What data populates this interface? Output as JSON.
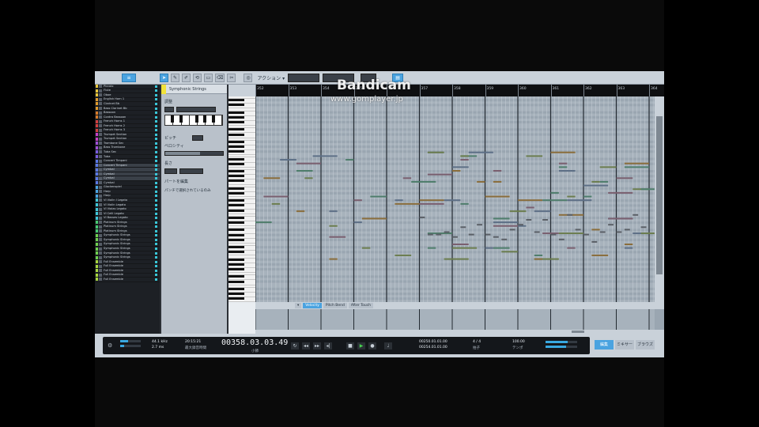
{
  "toolbar": {
    "buttons": [
      "✎",
      "✐",
      "⟲",
      "▭",
      "⌫",
      "✂"
    ],
    "action_label": "アクション ▾",
    "box1": "",
    "box2": "",
    "box3": ""
  },
  "tracks": [
    {
      "name": "Piccolo",
      "color": "#e8c53a"
    },
    {
      "name": "Flute",
      "color": "#e8c53a"
    },
    {
      "name": "Oboe",
      "color": "#e8c53a"
    },
    {
      "name": "English Horn 1",
      "color": "#e09a2c"
    },
    {
      "name": "Clarinet Bb",
      "color": "#e09a2c"
    },
    {
      "name": "Bass Clarinet Bb",
      "color": "#e09a2c"
    },
    {
      "name": "Bassoon",
      "color": "#d67b2a"
    },
    {
      "name": "Contra Bassoon",
      "color": "#d67b2a"
    },
    {
      "name": "French Horns 1",
      "color": "#d13f3f"
    },
    {
      "name": "French Horns 2",
      "color": "#d13f3f"
    },
    {
      "name": "French Horns 3",
      "color": "#d13f3f"
    },
    {
      "name": "Trumpet Section",
      "color": "#c83ec8"
    },
    {
      "name": "Trumpet Section",
      "color": "#c83ec8"
    },
    {
      "name": "Trombone Sec",
      "color": "#a04fd6"
    },
    {
      "name": "Bass Trombone",
      "color": "#a04fd6"
    },
    {
      "name": "Tuba Sec",
      "color": "#7a5ce0"
    },
    {
      "name": "Tuba",
      "color": "#7a5ce0"
    },
    {
      "name": "Concert Timpani",
      "color": "#5a78e6"
    },
    {
      "name": "Concert Timpani",
      "color": "#5a78e6"
    },
    {
      "name": "Cymbal",
      "color": "#5a78e6"
    },
    {
      "name": "Cymbal",
      "color": "#5a78e6"
    },
    {
      "name": "Cymbal",
      "color": "#5a78e6"
    },
    {
      "name": "Cymbal",
      "color": "#5a78e6"
    },
    {
      "name": "Glockenspiel",
      "color": "#4aa3e0"
    },
    {
      "name": "Harp",
      "color": "#4aa3e0"
    },
    {
      "name": "Harp",
      "color": "#4aa3e0"
    },
    {
      "name": "VI Violin I Legato",
      "color": "#3fc7d8"
    },
    {
      "name": "VI Violin Legato",
      "color": "#3fc7d8"
    },
    {
      "name": "VI Violas Legato",
      "color": "#3fc7d8"
    },
    {
      "name": "VI Celli Legato",
      "color": "#3fc7d8"
    },
    {
      "name": "VI Basses Legato",
      "color": "#3fc7d8"
    },
    {
      "name": "Platinum Strings",
      "color": "#47c870"
    },
    {
      "name": "Platinum Strings",
      "color": "#47c870"
    },
    {
      "name": "Platinum Strings",
      "color": "#47c870"
    },
    {
      "name": "Symphonic Strings",
      "color": "#6fd14f"
    },
    {
      "name": "Symphonic Strings",
      "color": "#6fd14f"
    },
    {
      "name": "Symphonic Strings",
      "color": "#6fd14f"
    },
    {
      "name": "Symphonic Strings",
      "color": "#6fd14f"
    },
    {
      "name": "Symphonic Strings",
      "color": "#6fd14f"
    },
    {
      "name": "Symphonic Strings",
      "color": "#6fd14f"
    },
    {
      "name": "Full Ensemble",
      "color": "#a8d63f"
    },
    {
      "name": "Full Ensemble",
      "color": "#a8d63f"
    },
    {
      "name": "Full Ensemble",
      "color": "#a8d63f"
    },
    {
      "name": "Full Ensemble",
      "color": "#a8d63f"
    },
    {
      "name": "Full Ensemble",
      "color": "#a8d63f"
    }
  ],
  "selected_track_indices": [
    18,
    19,
    20,
    21
  ],
  "inspector": {
    "title": "Symphonic Strings",
    "section_label": "調整",
    "btn1": "",
    "btn2": "",
    "label1": "ピッチ",
    "label2": "ベロシティ",
    "label3": "長さ",
    "btn3": "",
    "btn4": "",
    "option1": "パートを編集",
    "option2": "パンチで選択されているのみ"
  },
  "ruler": {
    "bars": [
      "352",
      "353",
      "354",
      "355",
      "356",
      "357",
      "358",
      "359",
      "360",
      "361",
      "362",
      "363",
      "364"
    ]
  },
  "lane_tabs": [
    "Velocity",
    "Pitch Bend",
    "After Touch"
  ],
  "transport": {
    "sample_rate": "44.1 kHz",
    "bit_depth": "2.7 ms",
    "record_time": "20:15:21",
    "record_label": "最大録音時間",
    "time": "00358.03.03.49",
    "time_unit": "小節",
    "loop_start": "00250.01.01.00",
    "loop_end": "00254.01.01.00",
    "tempo": "100.00",
    "tempo_label": "テンポ",
    "signature": "4 / 4",
    "signature_label": "拍子",
    "tabs": [
      "編集",
      "ミキサー",
      "ブラウズ"
    ]
  },
  "watermark": {
    "title": "Bandicam",
    "url": "www.gomplayer.jp"
  },
  "colors": {
    "accent": "#4aa3e0",
    "note": "#7a8f5a"
  }
}
